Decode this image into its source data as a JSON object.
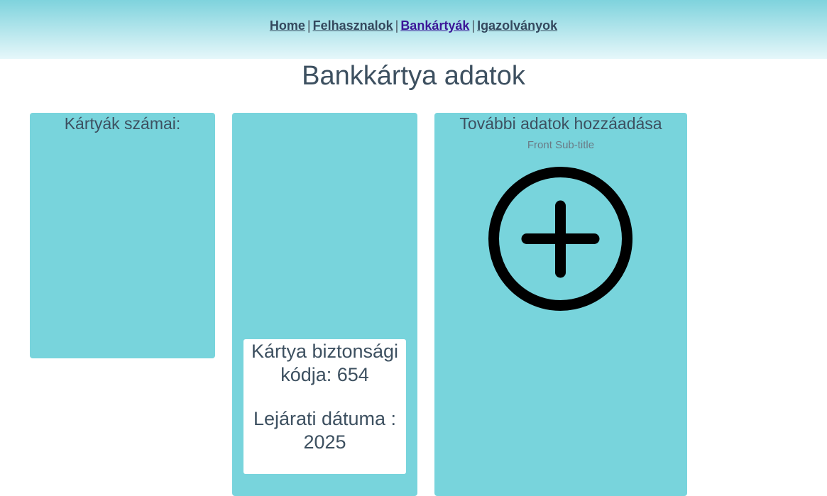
{
  "nav": {
    "items": [
      {
        "label": "Home"
      },
      {
        "label": "Felhasznalok"
      },
      {
        "label": "Bankártyák",
        "active": true
      },
      {
        "label": "Igazolványok"
      }
    ],
    "separator": "|"
  },
  "page": {
    "title": "Bankkártya adatok"
  },
  "cards": {
    "numbers": {
      "title": "Kártyák számai:"
    },
    "details": {
      "security_code": "Kártya biztonsági kódja: 654",
      "expiry": "Lejárati dátuma : 2025"
    },
    "add": {
      "title": "További adatok hozzáadása",
      "subtitle": "Front Sub-title",
      "icon": "plus-circle-icon"
    }
  },
  "colors": {
    "card_bg": "#78d4dc",
    "active_link": "#3b1798",
    "text": "#3d5060"
  }
}
